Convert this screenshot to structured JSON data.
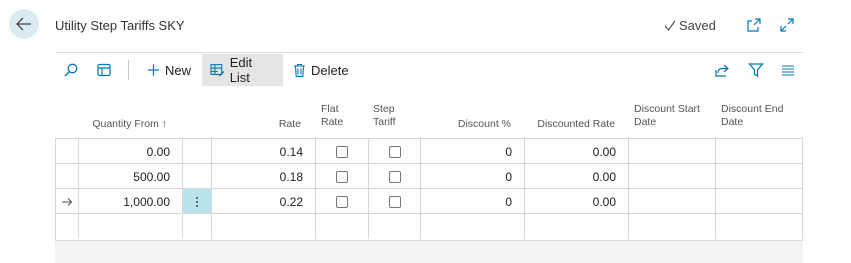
{
  "header": {
    "title": "Utility Step Tariffs SKY",
    "saved_label": "Saved"
  },
  "toolbar": {
    "new_label": "New",
    "edit_list_label": "Edit List",
    "delete_label": "Delete"
  },
  "columns": {
    "quantity_from": "Quantity From ↑",
    "rate": "Rate",
    "flat_rate_1": "Flat",
    "flat_rate_2": "Rate",
    "step_tariff_1": "Step",
    "step_tariff_2": "Tariff",
    "discount_pct": "Discount %",
    "discounted_rate": "Discounted Rate",
    "discount_start_1": "Discount Start",
    "discount_start_2": "Date",
    "discount_end_1": "Discount End",
    "discount_end_2": "Date"
  },
  "rows": [
    {
      "quantity_from": "0.00",
      "rate": "0.14",
      "flat_rate": false,
      "step_tariff": false,
      "discount_pct": "0",
      "discounted_rate": "0.00",
      "discount_start": "",
      "discount_end": ""
    },
    {
      "quantity_from": "500.00",
      "rate": "0.18",
      "flat_rate": false,
      "step_tariff": false,
      "discount_pct": "0",
      "discounted_rate": "0.00",
      "discount_start": "",
      "discount_end": ""
    },
    {
      "quantity_from": "1,000.00",
      "rate": "0.22",
      "flat_rate": false,
      "step_tariff": false,
      "discount_pct": "0",
      "discounted_rate": "0.00",
      "discount_start": "",
      "discount_end": ""
    }
  ],
  "icons": {
    "back": "back-arrow-icon",
    "saved": "checkmark-icon",
    "open_new_window": "open-in-new-window-icon",
    "expand": "expand-icon",
    "search": "search-icon",
    "layout": "layout-icon",
    "new": "plus-icon",
    "edit_list": "edit-list-icon",
    "delete": "trash-icon",
    "share": "share-icon",
    "filter": "filter-icon",
    "list_view": "list-view-icon",
    "row_pointer": "row-arrow-icon",
    "row_menu": "more-vertical-icon"
  },
  "colors": {
    "accent": "#0078b4",
    "back_button_bg": "#dcecf3",
    "selected_cell_bg": "#b9e4ec"
  }
}
